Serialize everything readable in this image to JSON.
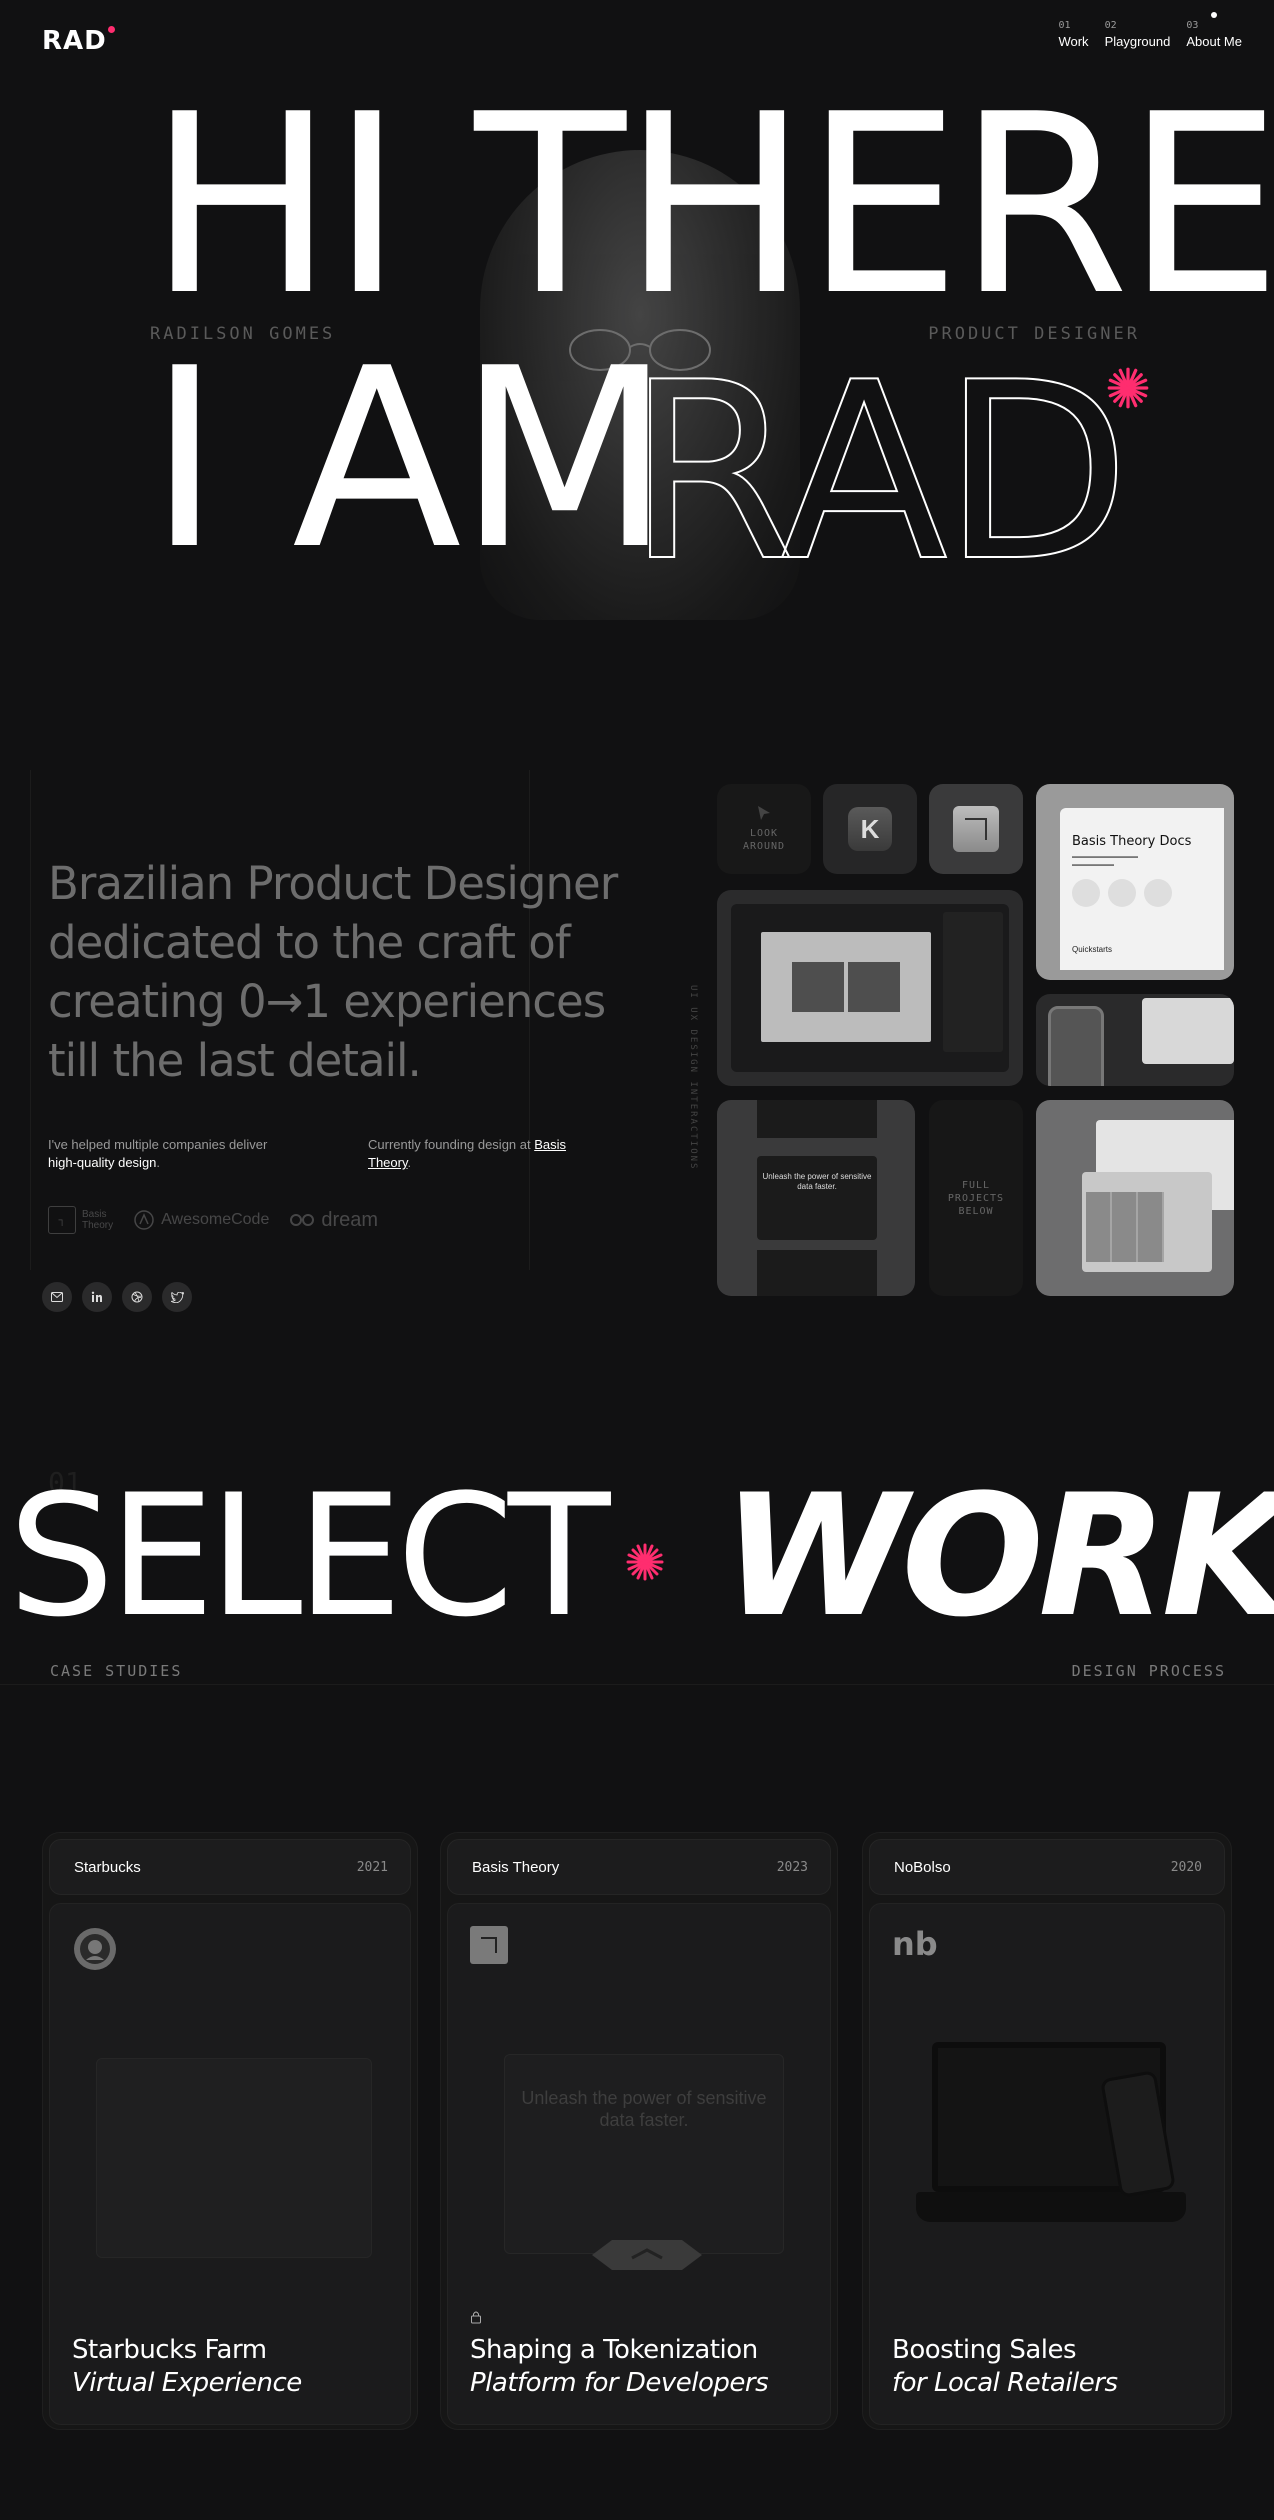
{
  "brand": {
    "logo_text": "RAD",
    "accent": "#ff2d6f"
  },
  "nav": [
    {
      "num": "01",
      "label": "Work"
    },
    {
      "num": "02",
      "label": "Playground"
    },
    {
      "num": "03",
      "label": "About Me"
    }
  ],
  "hero": {
    "line1": "HI THERE",
    "line2": "I AM",
    "outlined_word": "RAD",
    "name": "RADILSON GOMES",
    "role": "PRODUCT DESIGNER"
  },
  "intro": {
    "headline": "Brazilian Product Designer dedicated to the craft of creating 0→1 experiences till the last detail.",
    "blurb1_prefix": "I've helped multiple companies deliver ",
    "blurb1_strong": "high-quality design",
    "blurb1_suffix": ".",
    "blurb2_prefix": "Currently founding design at ",
    "blurb2_link": "Basis Theory",
    "blurb2_suffix": ".",
    "clients": [
      {
        "name": "Basis Theory",
        "line1": "Basis",
        "line2": "Theory"
      },
      {
        "name": "AwesomeCode"
      },
      {
        "name": "dream"
      }
    ],
    "socials": [
      "mail-icon",
      "linkedin-icon",
      "dribbble-icon",
      "twitter-icon"
    ]
  },
  "bento": {
    "vertical_label": "UI UX DESIGN INTERACTIONS",
    "look_around": "LOOK\nAROUND",
    "k_letter": "K",
    "docs_title": "Basis Theory Docs",
    "docs_quick": "Quickstarts",
    "landing_text": "Unleash the power of sensitive data faster.",
    "full_projects": "FULL\nPROJECTS\nBELOW"
  },
  "select_work": {
    "number": "01",
    "word1": "SELECT",
    "word2": "WORK",
    "left_label": "CASE STUDIES",
    "right_label": "DESIGN PROCESS"
  },
  "cards": [
    {
      "company": "Starbucks",
      "year": "2021",
      "title_main": "Starbucks Farm",
      "title_italic": "Virtual Experience",
      "logo": "starbucks-icon"
    },
    {
      "company": "Basis Theory",
      "year": "2023",
      "title_main": "Shaping a Tokenization",
      "title_italic": "Platform for Developers",
      "logo": "basis-theory-icon",
      "locked": true,
      "mock_text": "Unleash the power of sensitive data faster."
    },
    {
      "company": "NoBolso",
      "year": "2020",
      "title_main": "Boosting Sales",
      "title_italic": "for Local Retailers",
      "logo": "nobolso-icon",
      "logo_text": "nb"
    }
  ]
}
